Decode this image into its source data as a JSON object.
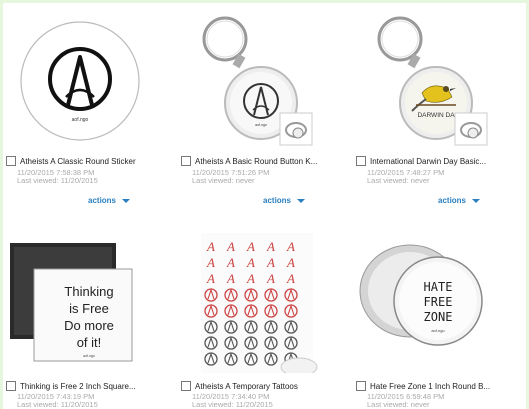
{
  "products": [
    {
      "title": "Atheists A Classic Round Sticker",
      "created": "11/20/2015 7:58:38 PM",
      "viewed": "Last viewed: 11/20/2015",
      "actions": "actions",
      "thumb_icon": "atheist-a-sticker-icon",
      "brand_text": "aof.ngo"
    },
    {
      "title": "Atheists A Basic Round Button K...",
      "created": "11/20/2015 7:51:26 PM",
      "viewed": "Last viewed: never",
      "actions": "actions",
      "thumb_icon": "atheist-a-keychain-icon",
      "brand_text": "aof.ngo"
    },
    {
      "title": "International Darwin Day Basic...",
      "created": "11/20/2015 7:48:27 PM",
      "viewed": "Last viewed: never",
      "actions": "actions",
      "thumb_icon": "darwin-day-keychain-icon",
      "brand_text": "DARWIN DA"
    },
    {
      "title": "Thinking is Free 2 Inch Square...",
      "created": "11/20/2015 7:43:19 PM",
      "viewed": "Last viewed: 11/20/2015",
      "thumb_icon": "thinking-free-magnet-icon",
      "thumb_text": [
        "Thinking",
        "is Free",
        "Do more",
        "of it!"
      ],
      "brand_text": "aof.ngo"
    },
    {
      "title": "Atheists A Temporary Tattoos",
      "created": "11/20/2015 7:34:40 PM",
      "viewed": "Last viewed: 11/20/2015",
      "thumb_icon": "tattoo-sheet-icon"
    },
    {
      "title": "Hate Free Zone 1 Inch Round B...",
      "created": "11/20/2015 6:59:48 PM",
      "viewed": "Last viewed: never",
      "thumb_icon": "hate-free-zone-button-icon",
      "thumb_text": [
        "HATE",
        "FREE",
        "ZONE"
      ],
      "brand_text": "aof.ngo"
    }
  ],
  "colors": {
    "background": "#e6f7dd",
    "actions_link": "#2a7fc0",
    "meta_text": "#aaaaaa",
    "tattoo_red": "#cc4444"
  }
}
